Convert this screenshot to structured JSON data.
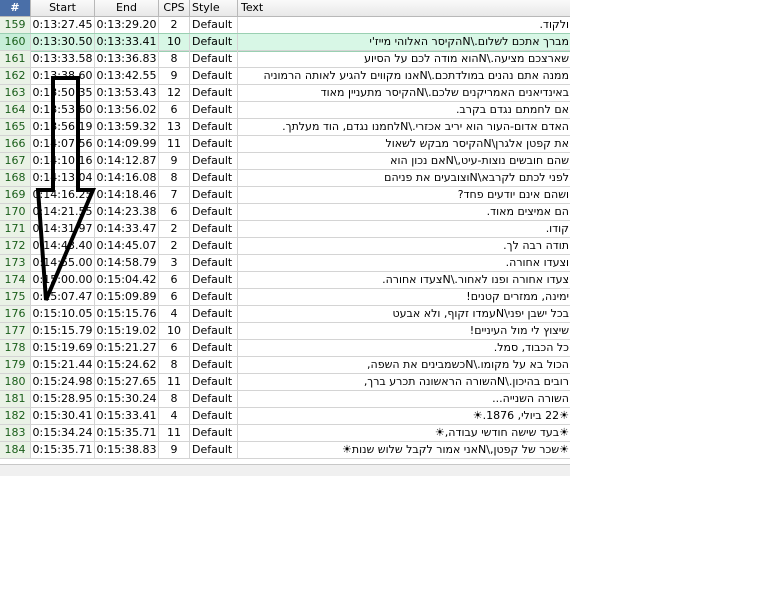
{
  "headers": {
    "num": "#",
    "start": "Start",
    "end": "End",
    "cps": "CPS",
    "style": "Style",
    "text": "Text"
  },
  "rows": [
    {
      "num": "159",
      "start": "0:13:27.45",
      "end": "0:13:29.20",
      "cps": "2",
      "style": "Default",
      "text": "ולקוד."
    },
    {
      "num": "160",
      "start": "0:13:30.50",
      "end": "0:13:33.41",
      "cps": "10",
      "style": "Default",
      "text": "מברך אתכם לשלום.\\Nהקיסר האלוהי מייז'י"
    },
    {
      "num": "161",
      "start": "0:13:33.58",
      "end": "0:13:36.83",
      "cps": "8",
      "style": "Default",
      "text": "שארצכם מציעה.\\Nהוא מודה לכם על הסיוע"
    },
    {
      "num": "162",
      "start": "0:13:38.60",
      "end": "0:13:42.55",
      "cps": "9",
      "style": "Default",
      "text": "ממנה אתם נהנים במולדתכם.\\Nאנו מקווים להגיע לאותה הרמוניה"
    },
    {
      "num": "163",
      "start": "0:13:50.35",
      "end": "0:13:53.43",
      "cps": "12",
      "style": "Default",
      "text": "באינדיאנים האמריקנים שלכם.\\Nהקיסר מתעניין מאוד"
    },
    {
      "num": "164",
      "start": "0:13:53.60",
      "end": "0:13:56.02",
      "cps": "6",
      "style": "Default",
      "text": "אם לחמתם נגדם בקרב."
    },
    {
      "num": "165",
      "start": "0:13:56.19",
      "end": "0:13:59.32",
      "cps": "13",
      "style": "Default",
      "text": "האדם אדום-העור הוא יריב אכזרי.\\Nלחמנו נגדם, הוד מעלתך."
    },
    {
      "num": "166",
      "start": "0:14:07.56",
      "end": "0:14:09.99",
      "cps": "11",
      "style": "Default",
      "text": "את קפטן אלגרן\\Nהקיסר מבקש לשאול"
    },
    {
      "num": "167",
      "start": "0:14:10.16",
      "end": "0:14:12.87",
      "cps": "9",
      "style": "Default",
      "text": "שהם חובשים נוצות-עיט,\\Nאם נכון הוא"
    },
    {
      "num": "168",
      "start": "0:14:13.04",
      "end": "0:14:16.08",
      "cps": "8",
      "style": "Default",
      "text": "לפני לכתם לקרבא\\Nוצובעים את פניהם"
    },
    {
      "num": "169",
      "start": "0:14:16.25",
      "end": "0:14:18.46",
      "cps": "7",
      "style": "Default",
      "text": "ושהם אינם יודעים פחד?"
    },
    {
      "num": "170",
      "start": "0:14:21.55",
      "end": "0:14:23.38",
      "cps": "6",
      "style": "Default",
      "text": "הם אמיצים מאוד."
    },
    {
      "num": "171",
      "start": "0:14:31.97",
      "end": "0:14:33.47",
      "cps": "2",
      "style": "Default",
      "text": "קודו."
    },
    {
      "num": "172",
      "start": "0:14:43.40",
      "end": "0:14:45.07",
      "cps": "2",
      "style": "Default",
      "text": "תודה רבה לך."
    },
    {
      "num": "173",
      "start": "0:14:55.00",
      "end": "0:14:58.79",
      "cps": "3",
      "style": "Default",
      "text": "וצעדו אחורה."
    },
    {
      "num": "174",
      "start": "0:15:00.00",
      "end": "0:15:04.42",
      "cps": "6",
      "style": "Default",
      "text": "צעדו אחורה ופנו לאחור.\\Nצעדו אחורה."
    },
    {
      "num": "175",
      "start": "0:15:07.47",
      "end": "0:15:09.89",
      "cps": "6",
      "style": "Default",
      "text": "ימינה, ממזרים קטנים!"
    },
    {
      "num": "176",
      "start": "0:15:10.05",
      "end": "0:15:15.76",
      "cps": "4",
      "style": "Default",
      "text": "בכל ישבן יפני\\Nעמדו זקוף, ולא אבעט"
    },
    {
      "num": "177",
      "start": "0:15:15.79",
      "cps": "10",
      "end": "0:15:19.02",
      "style": "Default",
      "text": "שיצוץ לי מול העיניים!"
    },
    {
      "num": "178",
      "start": "0:15:19.69",
      "end": "0:15:21.27",
      "cps": "6",
      "style": "Default",
      "text": "כל הכבוד, סמל."
    },
    {
      "num": "179",
      "start": "0:15:21.44",
      "end": "0:15:24.62",
      "cps": "8",
      "style": "Default",
      "text": "הכול בא על מקומו.\\Nכשמבינים את השפה,"
    },
    {
      "num": "180",
      "start": "0:15:24.98",
      "end": "0:15:27.65",
      "cps": "11",
      "style": "Default",
      "text": "רובים בהיכון.\\Nהשורה הראשונה תכרע ברך,"
    },
    {
      "num": "181",
      "start": "0:15:28.95",
      "end": "0:15:30.24",
      "cps": "8",
      "style": "Default",
      "text": "השורה השנייה..."
    },
    {
      "num": "182",
      "start": "0:15:30.41",
      "end": "0:15:33.41",
      "cps": "4",
      "style": "Default",
      "text": "☀22 ביולי, 1876.☀"
    },
    {
      "num": "183",
      "start": "0:15:34.24",
      "end": "0:15:35.71",
      "cps": "11",
      "style": "Default",
      "text": "☀בעד שישה חודשי עבודה,☀"
    },
    {
      "num": "184",
      "start": "0:15:35.71",
      "end": "0:15:38.83",
      "cps": "9",
      "style": "Default",
      "text": "☀שכר של קפטן,\\Nאני אמור לקבל שלוש שנות☀"
    }
  ],
  "selected_num": "160",
  "colors": {
    "header_num_bg": "#4a6fa8",
    "selected_bg": "#d8f7e6",
    "num_bg": "#eaf2e6"
  },
  "annotation": {
    "shape": "down-arrow-outline",
    "color": "#000000"
  }
}
